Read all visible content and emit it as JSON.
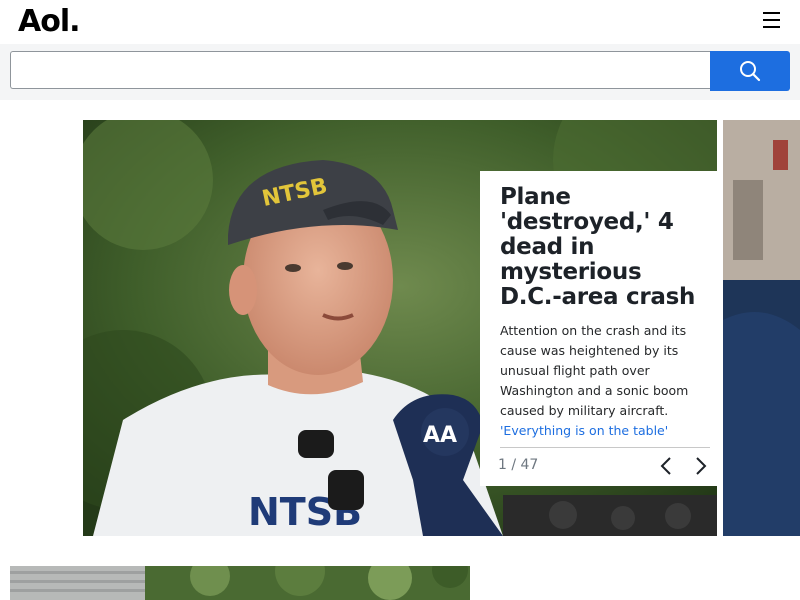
{
  "header": {
    "logo": "Aol.",
    "menu_icon": "hamburger-menu-icon"
  },
  "search": {
    "value": "",
    "placeholder": "",
    "button_icon": "search-icon"
  },
  "carousel": {
    "headline": "Plane 'destroyed,' 4 dead in mysterious D.C.-area crash",
    "summary": "Attention on the crash and its cause was heightened by its unusual flight path over Washington and a sonic boom caused by military aircraft.",
    "link": "'Everything is on the table'",
    "counter": "1 / 47",
    "prev_icon": "chevron-left-icon",
    "next_icon": "chevron-right-icon",
    "photo_text": {
      "cap": "NTSB",
      "shirt": "NTSB",
      "mic": "AA"
    }
  },
  "colors": {
    "accent": "#1d6ee0",
    "headline": "#1d2228",
    "counter": "#6e7780"
  }
}
